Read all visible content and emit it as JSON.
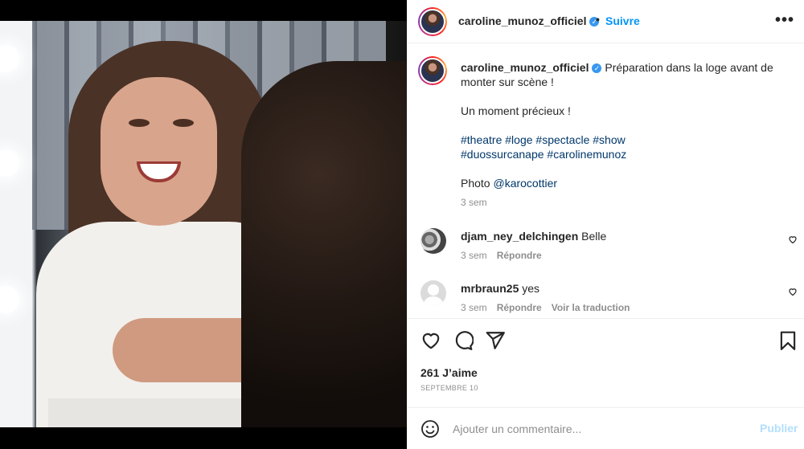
{
  "post": {
    "author": "caroline_munoz_officiel",
    "follow_label": "Suivre",
    "separator": "•",
    "more_label": "•••",
    "verified_mark": "✓"
  },
  "caption": {
    "line1": "Préparation dans la loge avant de monter sur scène !",
    "line2": "Un moment précieux !",
    "hashtags_row1": [
      "#theatre",
      "#loge",
      "#spectacle",
      "#show"
    ],
    "hashtags_row2": [
      "#duossurcanape",
      "#carolinemunoz"
    ],
    "photo_prefix": "Photo ",
    "photo_mention": "@karocottier",
    "time": "3 sem"
  },
  "comments": [
    {
      "user": "djam_ney_delchingen",
      "text": "Belle",
      "time": "3 sem",
      "reply": "Répondre",
      "translate": ""
    },
    {
      "user": "mrbraun25",
      "text": "yes",
      "time": "3 sem",
      "reply": "Répondre",
      "translate": "Voir la traduction"
    }
  ],
  "stats": {
    "likes": "261 J’aime",
    "date": "SEPTEMBRE 10"
  },
  "composer": {
    "placeholder": "Ajouter un commentaire...",
    "publish_label": "Publier"
  },
  "colors": {
    "link_blue": "#0095f6",
    "hashtag_blue": "#00376b",
    "muted": "#8e8e8e",
    "publish_disabled": "#b2dffc"
  },
  "icons": {
    "like": "heart-icon",
    "comment": "comment-icon",
    "share": "paper-plane-icon",
    "save": "bookmark-icon",
    "emoji": "smiley-icon"
  }
}
